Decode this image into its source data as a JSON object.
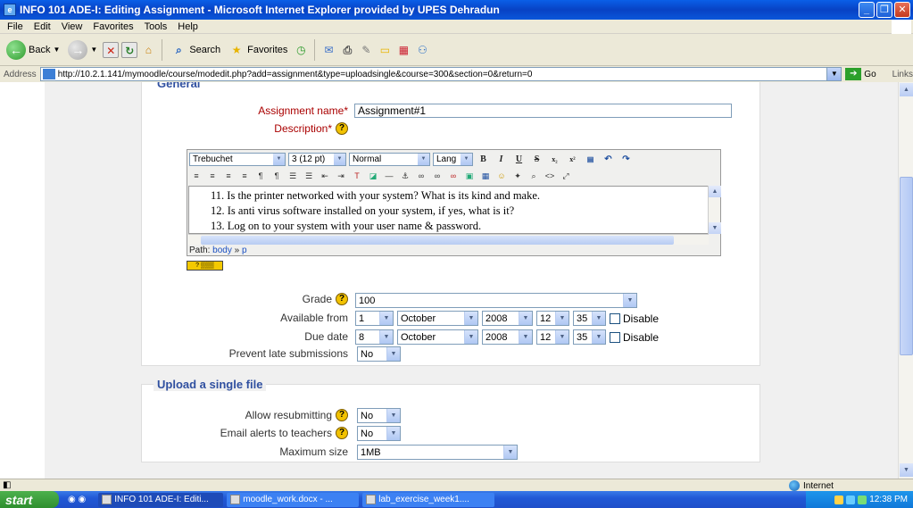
{
  "window": {
    "title": "INFO 101 ADE-I: Editing Assignment - Microsoft Internet Explorer provided by UPES Dehradun"
  },
  "menu": [
    "File",
    "Edit",
    "View",
    "Favorites",
    "Tools",
    "Help"
  ],
  "toolbar": {
    "back_label": "Back",
    "search_label": "Search",
    "favorites_label": "Favorites"
  },
  "address": {
    "label": "Address",
    "url": "http://10.2.1.141/mymoodle/course/modedit.php?add=assignment&type=uploadsingle&course=300&section=0&return=0",
    "go_label": "Go",
    "links_label": "Links"
  },
  "form": {
    "section_general": "General",
    "assignment_name_label": "Assignment name",
    "assignment_name_value": "Assignment#1",
    "required_mark": "*",
    "description_label": "Description",
    "help_glyph": "?",
    "editor": {
      "font": "Trebuchet",
      "size": "3 (12 pt)",
      "style": "Normal",
      "lang": "Lang",
      "lines": [
        "11.  Is the printer networked with your system? What is its kind and make.",
        "12.  Is anti virus software installed on your system, if yes, what is it?",
        "13.  Log on to your system with your user name & password."
      ],
      "path_label": "Path:",
      "path_body": "body",
      "path_sep": "»",
      "path_p": "p"
    },
    "grade_label": "Grade",
    "grade_value": "100",
    "available_from_label": "Available from",
    "available_from": {
      "day": "1",
      "month": "October",
      "year": "2008",
      "hour": "12",
      "minute": "35"
    },
    "due_date_label": "Due date",
    "due_date": {
      "day": "8",
      "month": "October",
      "year": "2008",
      "hour": "12",
      "minute": "35"
    },
    "disable_label": "Disable",
    "prevent_late_label": "Prevent late submissions",
    "prevent_late_value": "No",
    "section_upload": "Upload a single file",
    "allow_resubmit_label": "Allow resubmitting",
    "allow_resubmit_value": "No",
    "email_alerts_label": "Email alerts to teachers",
    "email_alerts_value": "No",
    "max_size_label": "Maximum size",
    "max_size_value": "1MB"
  },
  "status": {
    "zone": "Internet"
  },
  "taskbar": {
    "start": "start",
    "tasks": [
      "INFO 101 ADE-I: Editi...",
      "moodle_work.docx - ...",
      "lab_exercise_week1...."
    ],
    "clock": "12:38 PM"
  }
}
